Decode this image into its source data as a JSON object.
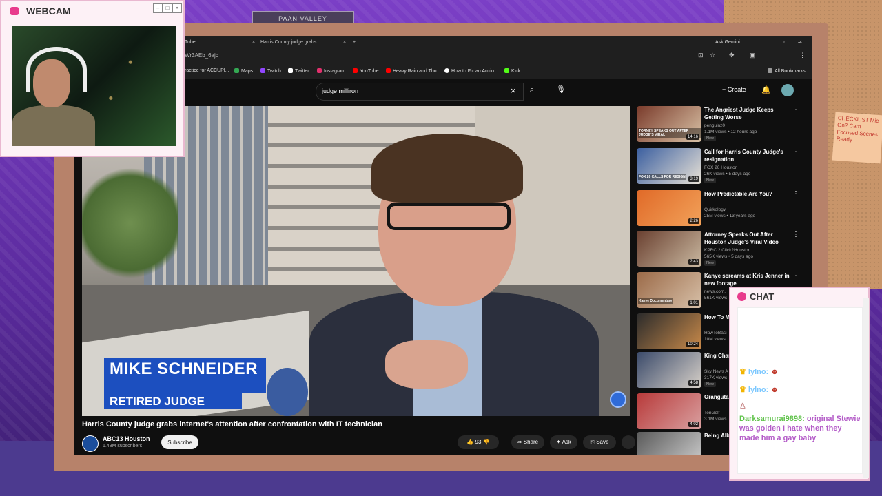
{
  "webcam": {
    "title": "WEBCAM",
    "minimize": "–",
    "maximize": "□",
    "close": "×"
  },
  "background_sign": "PAAN VALLEY",
  "sticky_note": "CHECKLIST Mic On? Cam Focused Scenes Ready",
  "browser": {
    "tabs": [
      {
        "label": "Tube",
        "close": "×"
      },
      {
        "label": "Harris County judge grabs",
        "close": "×"
      }
    ],
    "new_tab": "+",
    "ask_gemini": "Ask Gemini",
    "url": "Wr3AEb_6ajc",
    "bookmarks": [
      {
        "label": "ractice for ACCUPI...",
        "color": "#888888"
      },
      {
        "label": "Maps",
        "color": "#34a853"
      },
      {
        "label": "Twitch",
        "color": "#9146ff"
      },
      {
        "label": "Twitter",
        "color": "#ffffff"
      },
      {
        "label": "Instagram",
        "color": "#e1306c"
      },
      {
        "label": "YouTube",
        "color": "#ff0000"
      },
      {
        "label": "Heavy Rain and Thu...",
        "color": "#ff0000"
      },
      {
        "label": "How to Fix an Anxio...",
        "color": "#ffffff"
      },
      {
        "label": "Kick",
        "color": "#53fc18"
      }
    ],
    "all_bookmarks": "All Bookmarks"
  },
  "youtube": {
    "search_value": "judge milliron",
    "create_label": "Create",
    "video": {
      "lower_third_name": "MIKE SCHNEIDER",
      "lower_third_role": "RETIRED JUDGE",
      "title": "Harris County judge grabs internet's attention after confrontation with IT technician",
      "channel": "ABC13 Houston",
      "subscribers": "1.48M subscribers",
      "subscribe_label": "Subscribe",
      "likes": "93",
      "share_label": "Share",
      "ask_label": "Ask",
      "save_label": "Save"
    },
    "recommendations": [
      {
        "title": "The Angriest Judge Keeps Getting Worse",
        "channel": "penguinz0",
        "meta": "1.1M views • 12 hours ago",
        "duration": "14:16",
        "badge": "New",
        "thumb_text": "TORNEY SPEAKS OUT AFTER JUDGE'S VIRAL",
        "colors": [
          "#7a3b2b",
          "#d9c2a6"
        ]
      },
      {
        "title": "Call for Harris County Judge's resignation",
        "channel": "FOX 26 Houston",
        "meta": "26K views • 5 days ago",
        "duration": "3:19",
        "badge": "New",
        "thumb_text": "FOX 26 CALLS FOR RESIGN",
        "colors": [
          "#3b5fa0",
          "#e9e2d6"
        ]
      },
      {
        "title": "How Predictable Are You?",
        "channel": "Quirkology",
        "meta": "25M views • 13 years ago",
        "duration": "2:26",
        "badge": "",
        "thumb_text": "",
        "colors": [
          "#e06a28",
          "#f2a25a"
        ]
      },
      {
        "title": "Attorney Speaks Out After Houston Judge's Viral Video",
        "channel": "KPRC 2 Click2Houston",
        "meta": "565K views • 5 days ago",
        "duration": "2:43",
        "badge": "New",
        "thumb_text": "",
        "colors": [
          "#6a4030",
          "#c9b8a0"
        ]
      },
      {
        "title": "Kanye screams at Kris Jenner in new footage",
        "channel": "news.com.",
        "meta": "561K views",
        "duration": "1:01",
        "badge": "",
        "thumb_text": "Kanye Documentary",
        "colors": [
          "#9b6a48",
          "#d7c0a8"
        ]
      },
      {
        "title": "How To M",
        "channel": "HowToBasi",
        "meta": "10M views",
        "duration": "10:24",
        "badge": "",
        "thumb_text": "",
        "colors": [
          "#2b2b2b",
          "#c98a4a"
        ]
      },
      {
        "title": "King Char issuing R",
        "channel": "Sky News A",
        "meta": "317K views",
        "duration": "4:58",
        "badge": "New",
        "thumb_text": "",
        "colors": [
          "#3a4a6a",
          "#d7d0c8"
        ]
      },
      {
        "title": "Orangutar",
        "channel": "TenGolf",
        "meta": "3.1M views",
        "duration": "4:02",
        "badge": "",
        "thumb_text": "",
        "colors": [
          "#b83a3a",
          "#d9a0a0"
        ]
      },
      {
        "title": "Being Alb Horrifying",
        "channel": "",
        "meta": "",
        "duration": "",
        "badge": "",
        "thumb_text": "",
        "colors": [
          "#5a5a5a",
          "#d0d0d0"
        ]
      }
    ]
  },
  "chat": {
    "title": "CHAT",
    "messages": [
      {
        "user": "lylno:",
        "text": "",
        "user_color": "#7cc8ff"
      },
      {
        "user": "lylno:",
        "text": "",
        "user_color": "#7cc8ff"
      },
      {
        "user": "Darksamurai9898:",
        "text": "original Stewie was golden I hate when they made him a gay baby",
        "user_color": "#5fc24a"
      }
    ]
  }
}
